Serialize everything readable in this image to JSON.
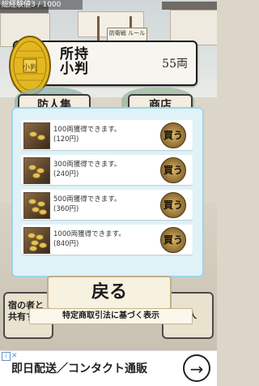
{
  "top_ticker": "総経験値3 / 1000",
  "notice_sign": "防衛戦 ルール",
  "coin": {
    "label_line1": "所持",
    "label_line2": "小判",
    "amount": "55両",
    "koban_text": "小判"
  },
  "menu_tabs": [
    "防人集",
    "商店"
  ],
  "shop": {
    "buy_label": "買う",
    "items": [
      {
        "desc": "100両獲得できます。",
        "price": "(120円)"
      },
      {
        "desc": "300両獲得できます。",
        "price": "(240円)"
      },
      {
        "desc": "500両獲得できます。",
        "price": "(360円)"
      },
      {
        "desc": "1000両獲得できます。",
        "price": "(840円)"
      }
    ]
  },
  "back_label": "戻る",
  "law_link": "特定商取引法に基づく表示",
  "bottom_tabs": {
    "left_line1": "宿の者と",
    "left_line2": "共有す",
    "right": "防人"
  },
  "ad": {
    "text": "即日配送／コンタクト通販",
    "info_icon": "i",
    "close_icon": "✕",
    "arrow": "→"
  }
}
